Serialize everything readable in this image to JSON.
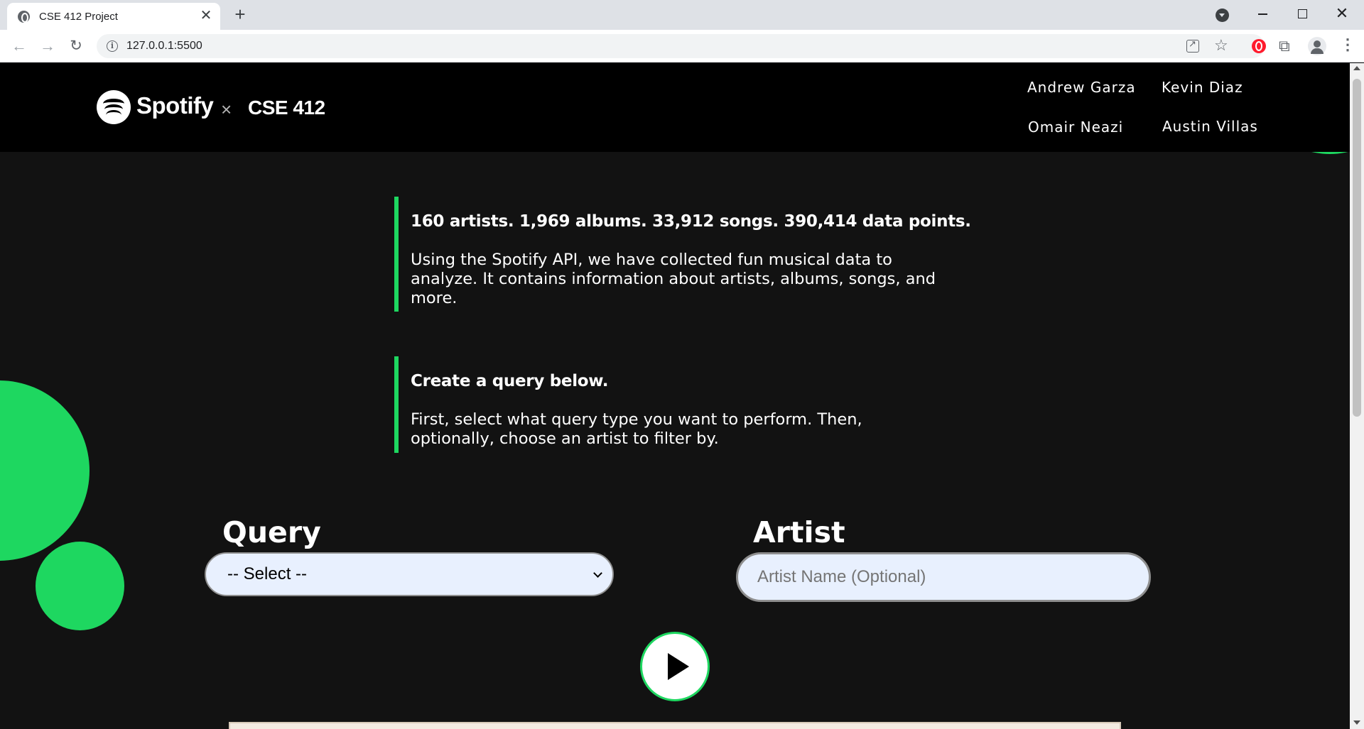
{
  "browser": {
    "tab_title": "CSE 412 Project",
    "tab_close": "✕",
    "new_tab": "+",
    "url": "127.0.0.1:5500",
    "info_icon": "i",
    "star_icon": "☆",
    "puzzle_icon": "⧉",
    "menu_icon": "⋮",
    "back_icon": "←",
    "forward_icon": "→",
    "reload_icon": "↻",
    "close_window": "✕"
  },
  "header": {
    "brand_name": "Spotify",
    "brand_separator": "×",
    "course": "CSE 412",
    "team": [
      "Andrew Garza",
      "Kevin Diaz",
      "Omair Neazi",
      "Austin Villas"
    ]
  },
  "intro": {
    "stats_heading": "160 artists. 1,969 albums. 33,912 songs. 390,414 data points.",
    "stats_body": "Using the Spotify API, we have collected fun musical data to analyze. It contains information about artists, albums, songs, and more.",
    "query_heading": "Create a query below.",
    "query_body": "First, select what query type you want to perform. Then, optionally, choose an artist to filter by."
  },
  "form": {
    "query_label": "Query",
    "query_selected": "-- Select --",
    "artist_label": "Artist",
    "artist_placeholder": "Artist Name (Optional)",
    "artist_value": ""
  },
  "colors": {
    "accent": "#1ed760",
    "header_bg": "#000000",
    "page_bg": "#121212",
    "input_bg": "#e8f0fe"
  }
}
